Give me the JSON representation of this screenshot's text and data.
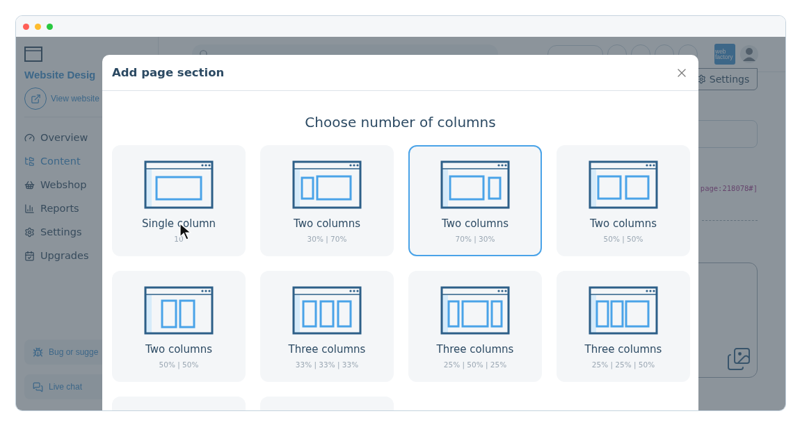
{
  "sidebar": {
    "title": "Website Desig",
    "view_link": "View website",
    "items": [
      {
        "label": "Overview",
        "selected": false
      },
      {
        "label": "Content",
        "selected": true
      },
      {
        "label": "Webshop",
        "selected": false
      },
      {
        "label": "Reports",
        "selected": false
      },
      {
        "label": "Settings",
        "selected": false
      },
      {
        "label": "Upgrades",
        "selected": false
      }
    ],
    "footer": [
      "Bug or sugge",
      "Live chat"
    ]
  },
  "topbar": {
    "logo": "web factory"
  },
  "page": {
    "settings_button": "Settings",
    "code": "page:218078#]"
  },
  "dialog": {
    "title": "Add page section",
    "heading": "Choose number of columns",
    "options": [
      {
        "kind": "single",
        "title": "Single column",
        "subtitle": "10",
        "selected": false
      },
      {
        "kind": "narrow-wide",
        "title": "Two columns",
        "subtitle": "30% | 70%",
        "selected": false
      },
      {
        "kind": "wide-narrow",
        "title": "Two columns",
        "subtitle": "70% | 30%",
        "selected": true
      },
      {
        "kind": "halves",
        "title": "Two columns",
        "subtitle": "50% | 50%",
        "selected": false
      },
      {
        "kind": "halves-tall",
        "title": "Two columns",
        "subtitle": "50% | 50%",
        "selected": false
      },
      {
        "kind": "thirds",
        "title": "Three columns",
        "subtitle": "33% | 33% | 33%",
        "selected": false
      },
      {
        "kind": "quarter-half-quarter",
        "title": "Three columns",
        "subtitle": "25% | 50% | 25%",
        "selected": false
      },
      {
        "kind": "quarter-quarter-half",
        "title": "Three columns",
        "subtitle": "25% | 25% | 50%",
        "selected": false
      },
      {
        "kind": "clipped",
        "selected": false
      },
      {
        "kind": "clipped",
        "selected": false
      }
    ]
  }
}
